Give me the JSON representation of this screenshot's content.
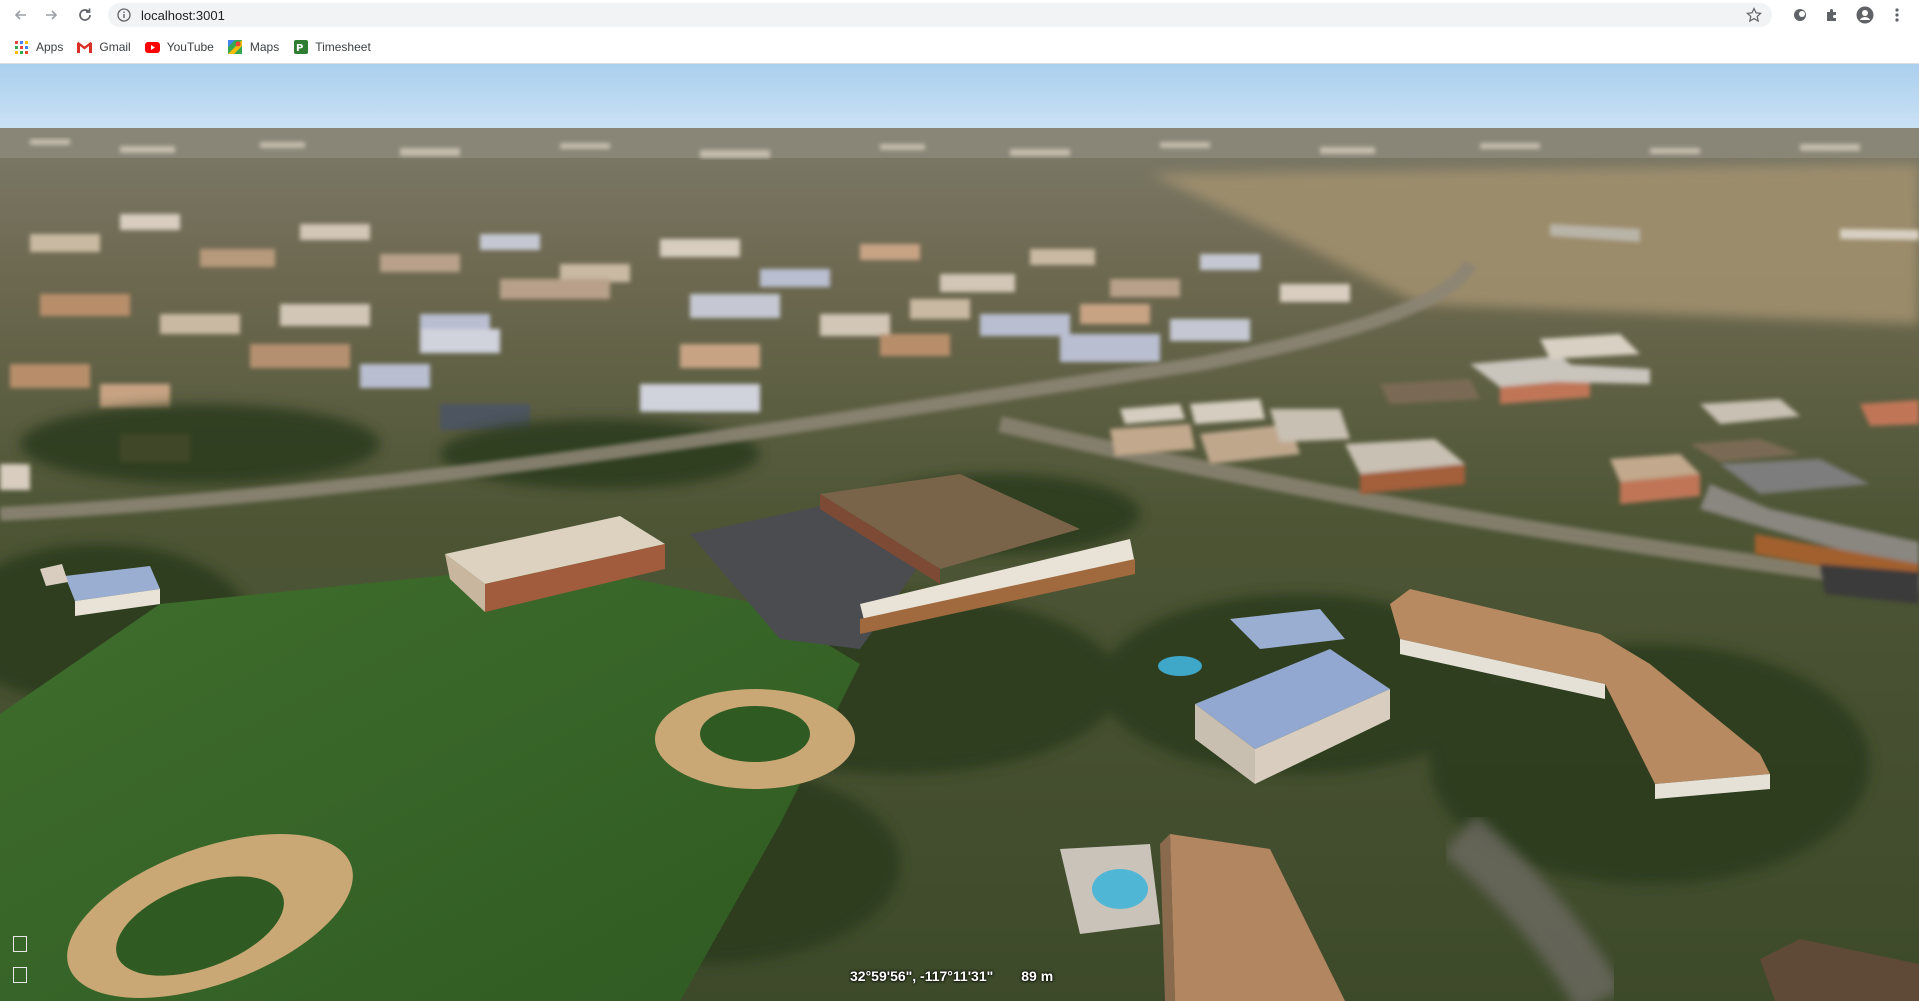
{
  "browser": {
    "url": "localhost:3001",
    "bookmarks": [
      {
        "label": "Apps",
        "icon": "apps-grid-icon"
      },
      {
        "label": "Gmail",
        "icon": "gmail-icon"
      },
      {
        "label": "YouTube",
        "icon": "youtube-icon"
      },
      {
        "label": "Maps",
        "icon": "maps-icon"
      },
      {
        "label": "Timesheet",
        "icon": "timesheet-icon"
      }
    ]
  },
  "map": {
    "coordinates": "32°59'56\", -117°11'31\"",
    "altitude": "89 m"
  },
  "colors": {
    "sky": "#b8d8f2",
    "terrain_far": "#8a8a70",
    "grass": "#3f6e2d",
    "parking": "#4a4c50"
  }
}
